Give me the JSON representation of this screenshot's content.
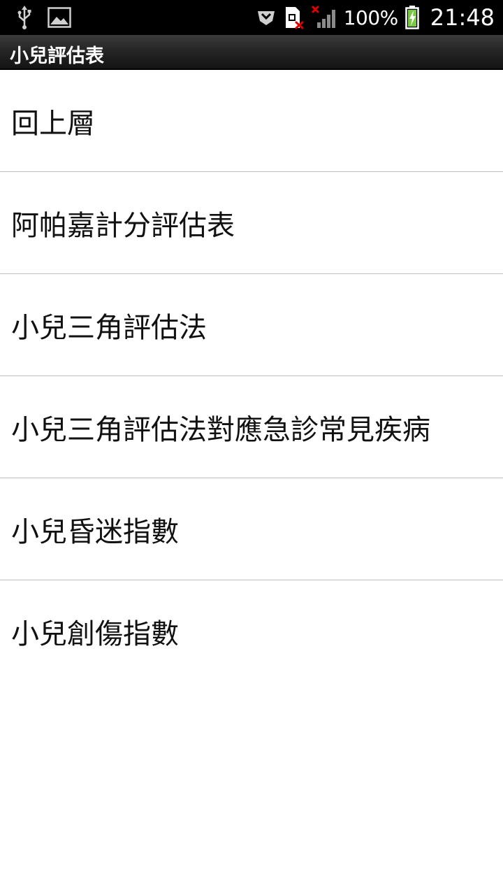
{
  "status_bar": {
    "icons_left": [
      "usb-icon",
      "image-icon"
    ],
    "icons_right": [
      "shield-icon",
      "sim-error-icon",
      "signal-icon",
      "battery-charging-icon"
    ],
    "battery_percent": "100%",
    "time": "21:48",
    "accent_color": "#7ac943"
  },
  "title_bar": {
    "title": "小兒評估表"
  },
  "menu": {
    "items": [
      {
        "label": "回上層"
      },
      {
        "label": "阿帕嘉計分評估表"
      },
      {
        "label": "小兒三角評估法"
      },
      {
        "label": "小兒三角評估法對應急診常見疾病"
      },
      {
        "label": "小兒昏迷指數"
      },
      {
        "label": "小兒創傷指數"
      }
    ]
  }
}
